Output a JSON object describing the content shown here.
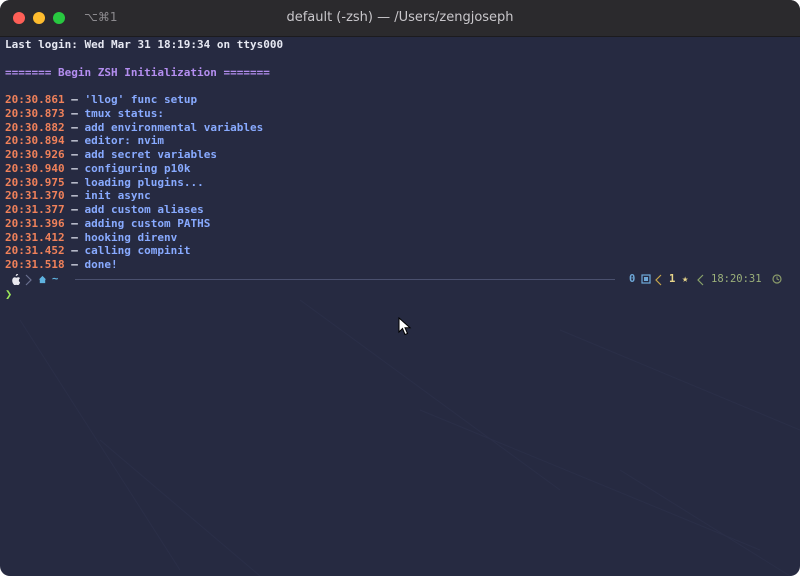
{
  "window": {
    "shortcut": "⌥⌘1",
    "title": "default (-zsh) — /Users/zengjoseph"
  },
  "terminal": {
    "last_login": "Last login: Wed Mar 31 18:19:34 on ttys000",
    "banner": "======= Begin ZSH Initialization =======",
    "log": [
      {
        "ts": "20:30.861",
        "msg": "'llog' func setup"
      },
      {
        "ts": "20:30.873",
        "msg": "tmux status:"
      },
      {
        "ts": "20:30.882",
        "msg": "add environmental variables"
      },
      {
        "ts": "20:30.894",
        "msg": "editor: nvim"
      },
      {
        "ts": "20:30.926",
        "msg": "add secret variables"
      },
      {
        "ts": "20:30.940",
        "msg": "configuring p10k"
      },
      {
        "ts": "20:30.975",
        "msg": "loading plugins..."
      },
      {
        "ts": "20:31.370",
        "msg": "init async"
      },
      {
        "ts": "20:31.377",
        "msg": "add custom aliases"
      },
      {
        "ts": "20:31.396",
        "msg": "adding custom PATHS"
      },
      {
        "ts": "20:31.412",
        "msg": "hooking direnv"
      },
      {
        "ts": "20:31.452",
        "msg": "calling compinit"
      },
      {
        "ts": "20:31.518",
        "msg": "done!"
      }
    ],
    "separator": "–",
    "prompt": {
      "left_home": "~",
      "jobs": "0",
      "stars": "1",
      "star_icon": "★",
      "time": "18:20:31",
      "prompt_char": "❯"
    }
  },
  "colors": {
    "background": "#262a41",
    "timestamp": "#f0815a",
    "message": "#88aaff",
    "banner": "#b48ef0",
    "prompt_char": "#9be65a"
  }
}
